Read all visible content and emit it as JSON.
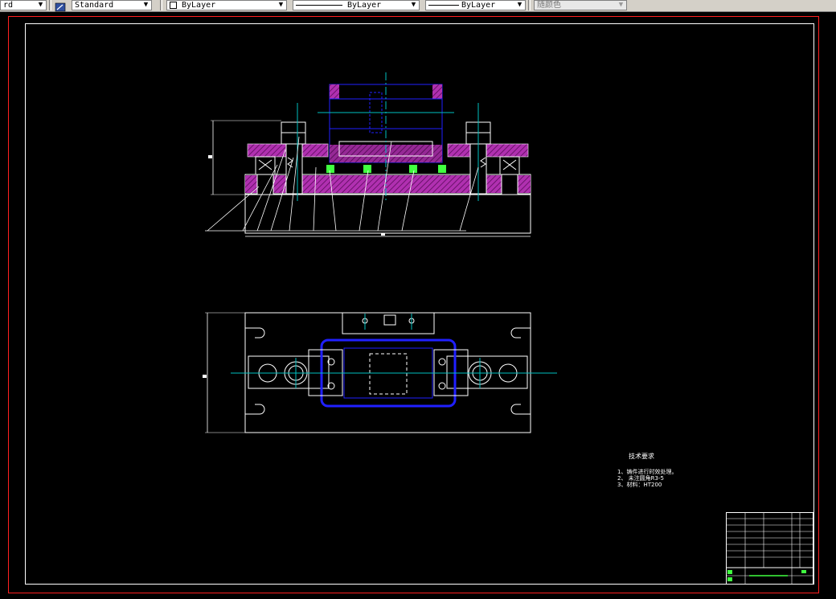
{
  "toolbar": {
    "text_style_partial": "rd",
    "dim_style": "Standard",
    "layer": "ByLayer",
    "linetype": "ByLayer",
    "lineweight": "ByLayer",
    "color": "随颜色",
    "dropdown_arrow": "▼"
  },
  "notes": {
    "title": "技术要求",
    "lines": [
      "1、铸件进行时效处理。",
      "2、 未注圆角R3-5",
      "3、材料：HT200"
    ]
  },
  "colors": {
    "drawing_bg": "#000000",
    "outline": "#ffffff",
    "hatch": "#a020a0",
    "part_blue": "#2020ff",
    "center_line": "#00c0c0",
    "green_part": "#40ff40",
    "border_red": "#ff2020"
  }
}
